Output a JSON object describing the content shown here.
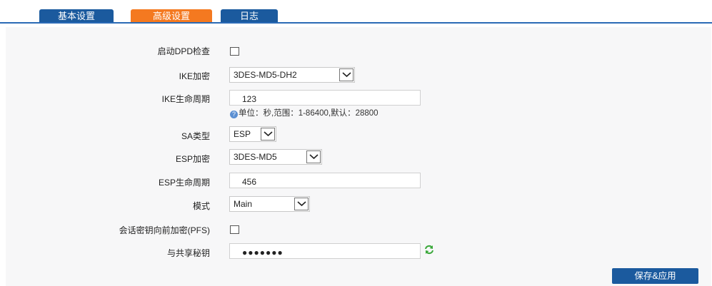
{
  "tabs": [
    {
      "label": "基本设置"
    },
    {
      "label": "高级设置",
      "active": true
    },
    {
      "label": "日志"
    }
  ],
  "form": {
    "dpd": {
      "label": "启动DPD检查",
      "checked": false
    },
    "ike_encrypt": {
      "label": "IKE加密",
      "value": "3DES-MD5-DH2"
    },
    "ike_lifetime": {
      "label": "IKE生命周期",
      "value": "123",
      "hint": "单位：秒,范围：1-86400,默认：28800"
    },
    "sa_type": {
      "label": "SA类型",
      "value": "ESP"
    },
    "esp_encrypt": {
      "label": "ESP加密",
      "value": "3DES-MD5"
    },
    "esp_lifetime": {
      "label": "ESP生命周期",
      "value": "456"
    },
    "mode": {
      "label": "模式",
      "value": "Main"
    },
    "pfs": {
      "label": "会话密钥向前加密(PFS)",
      "checked": false
    },
    "psk": {
      "label": "与共享秘钥",
      "value": "●●●●●●●"
    }
  },
  "actions": {
    "save_label": "保存&应用"
  },
  "colors": {
    "tab_blue": "#1b5a9e",
    "tab_active": "#f47920",
    "button": "#1b5a9e"
  },
  "icons": {
    "hint": "help-circle-icon",
    "refresh": "refresh-icon",
    "dropdown": "chevron-down-icon"
  }
}
